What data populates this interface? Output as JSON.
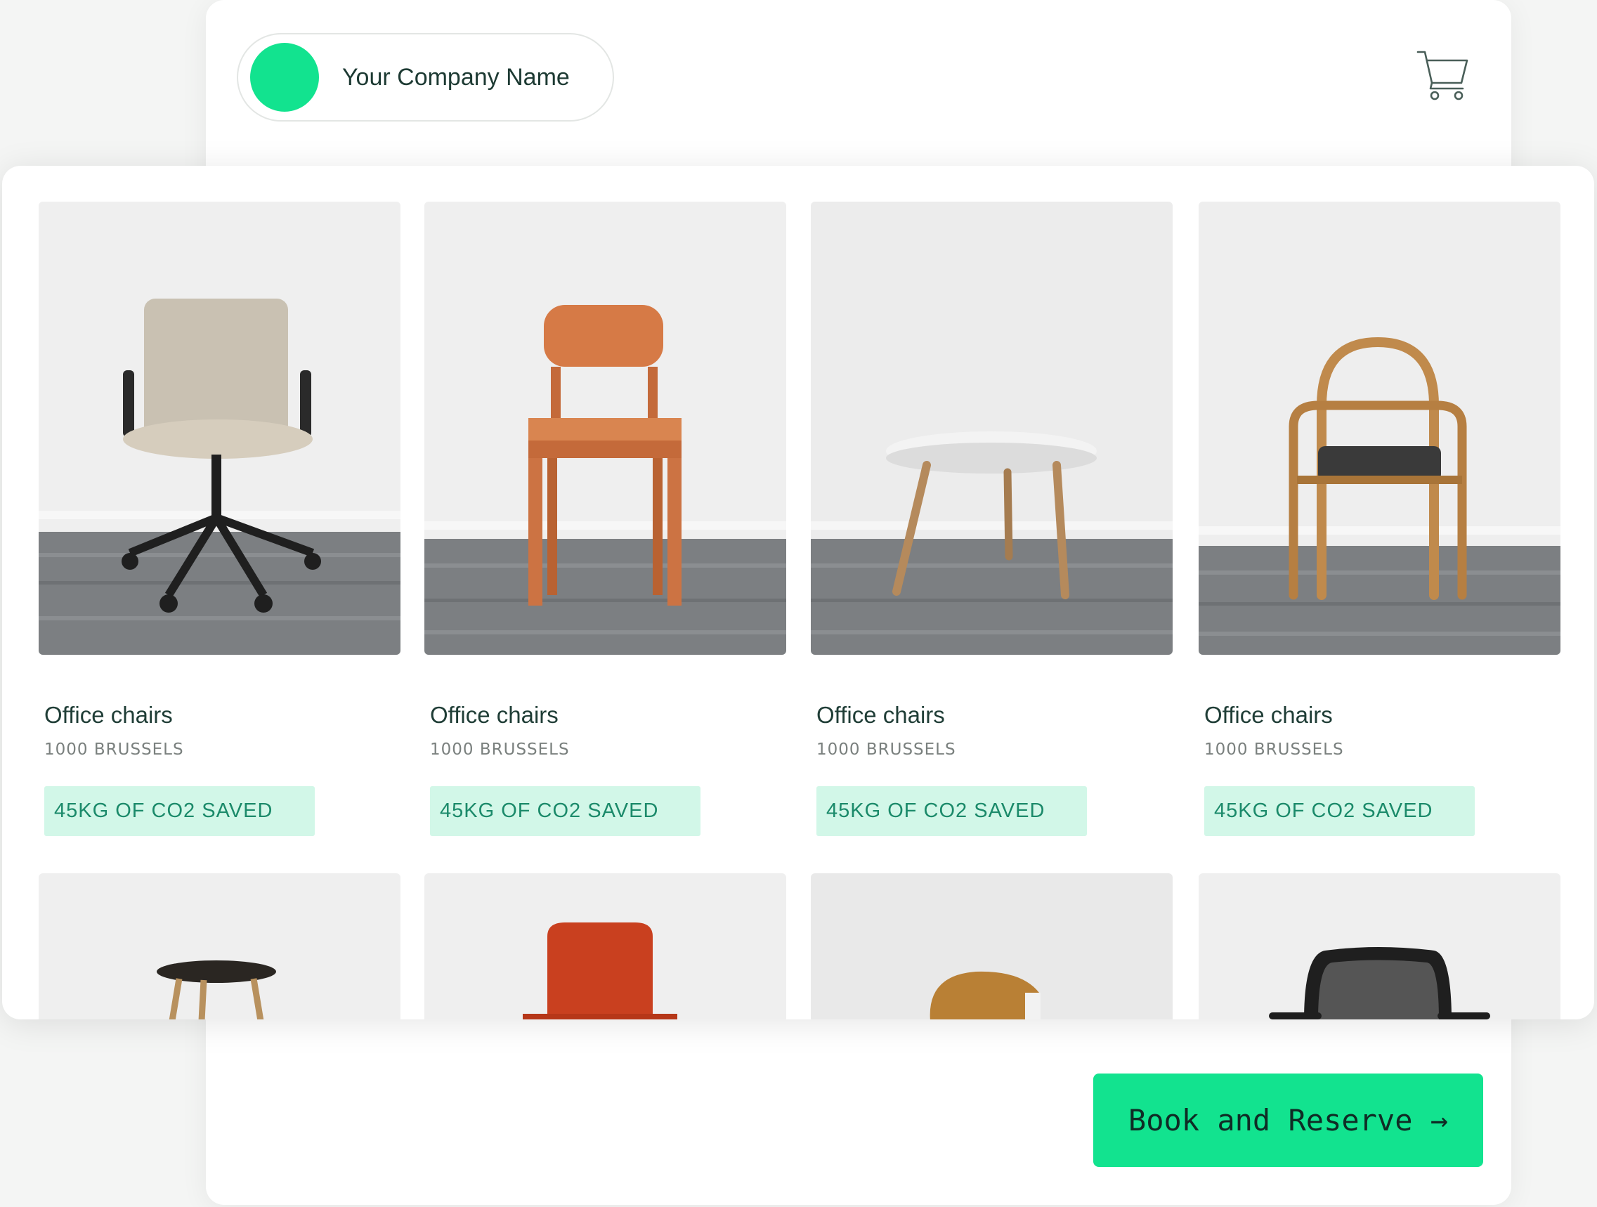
{
  "header": {
    "company_name": "Your Company Name",
    "cart_icon": "cart-icon"
  },
  "colors": {
    "brand_green": "#12e38f",
    "badge_bg": "#d2f7e8",
    "badge_text": "#1b8a6a",
    "title_text": "#1f3d36"
  },
  "products": [
    {
      "title": "Office chairs",
      "location": "1000 BRUSSELS",
      "badge": "45KG OF CO2 SAVED",
      "image": "office-chair-photo"
    },
    {
      "title": "Office chairs",
      "location": "1000 BRUSSELS",
      "badge": "45KG OF CO2 SAVED",
      "image": "wooden-chair-photo"
    },
    {
      "title": "Office chairs",
      "location": "1000 BRUSSELS",
      "badge": "45KG OF CO2 SAVED",
      "image": "round-table-photo"
    },
    {
      "title": "Office chairs",
      "location": "1000 BRUSSELS",
      "badge": "45KG OF CO2 SAVED",
      "image": "bentwood-chair-photo"
    }
  ],
  "products_row2": [
    {
      "image": "stool-photo"
    },
    {
      "image": "red-chair-photo"
    },
    {
      "image": "plywood-chair-photo"
    },
    {
      "image": "mesh-chair-photo"
    }
  ],
  "cta": {
    "book_label": "Book and Reserve →"
  }
}
